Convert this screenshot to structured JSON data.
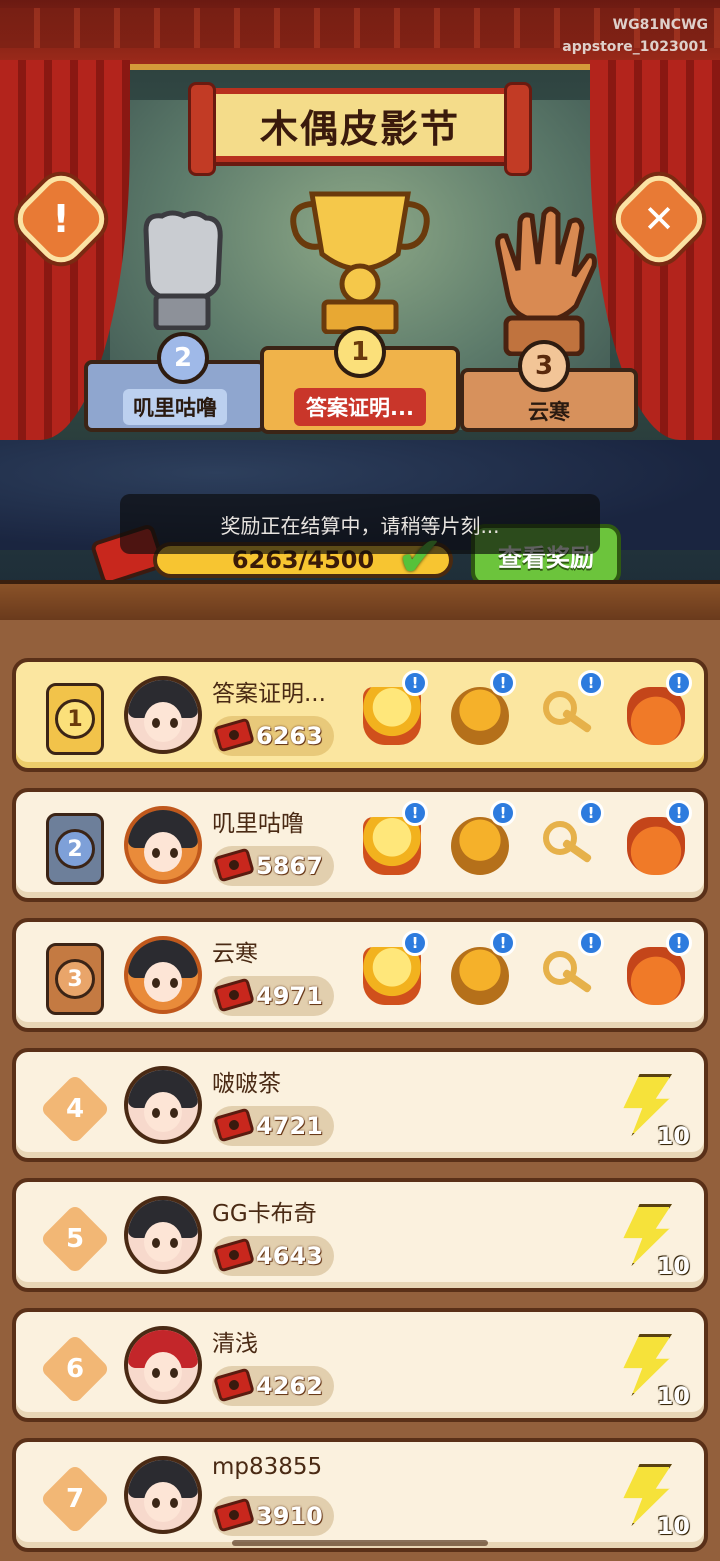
{
  "watermark": {
    "line1": "WG81NCWG",
    "line2": "appstore_1023001"
  },
  "title": "木偶皮影节",
  "buttons": {
    "info_glyph": "!",
    "close_glyph": "✕",
    "view_rewards": "查看奖励"
  },
  "podium": {
    "first": {
      "rank": "1",
      "name": "答案证明..."
    },
    "second": {
      "rank": "2",
      "name": "叽里咕噜"
    },
    "third": {
      "rank": "3",
      "name": "云寒"
    }
  },
  "settle_notice": "奖励正在结算中，请稍等片刻...",
  "progress": {
    "text": "6263/4500",
    "current": 6263,
    "target": 4500
  },
  "check_glyph": "✔",
  "rows": [
    {
      "rank": "1",
      "name": "答案证明...",
      "score": "6263",
      "badge_glyph": "!"
    },
    {
      "rank": "2",
      "name": "叽里咕噜",
      "score": "5867",
      "badge_glyph": "!"
    },
    {
      "rank": "3",
      "name": "云寒",
      "score": "4971",
      "badge_glyph": "!"
    },
    {
      "rank": "4",
      "name": "啵啵茶",
      "score": "4721",
      "energy": "10"
    },
    {
      "rank": "5",
      "name": "GG卡布奇",
      "score": "4643",
      "energy": "10"
    },
    {
      "rank": "6",
      "name": "清浅",
      "score": "4262",
      "energy": "10"
    },
    {
      "rank": "7",
      "name": "mp83855",
      "score": "3910",
      "energy": "10"
    }
  ],
  "icons": {
    "reward_items": [
      "gold-pile-icon",
      "treasure-basket-icon",
      "key-icon",
      "lucky-bag-icon"
    ],
    "energy": "lightning-bolt-icon",
    "score": "ticket-icon"
  },
  "colors": {
    "accent_red": "#b8311f",
    "gold": "#f4dc8a",
    "button_green": "#6cc43c",
    "badge_blue": "#2d7bde"
  }
}
